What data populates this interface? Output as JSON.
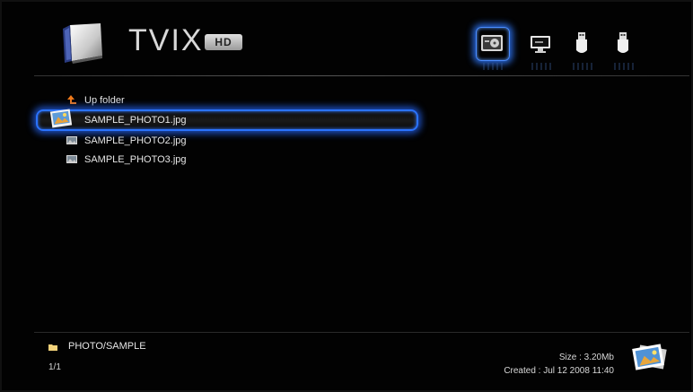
{
  "app": {
    "brand": "TVIX",
    "brand_badge": "HD"
  },
  "sources": [
    {
      "name": "hdd-source",
      "active": true
    },
    {
      "name": "network-source",
      "active": false
    },
    {
      "name": "usb-source-1",
      "active": false
    },
    {
      "name": "usb-source-2",
      "active": false
    }
  ],
  "list": {
    "up_label": "Up folder",
    "items": [
      {
        "label": "SAMPLE_PHOTO1.jpg",
        "selected": true
      },
      {
        "label": "SAMPLE_PHOTO2.jpg",
        "selected": false
      },
      {
        "label": "SAMPLE_PHOTO3.jpg",
        "selected": false
      }
    ]
  },
  "footer": {
    "path": "PHOTO/SAMPLE",
    "pager": "1/1",
    "size": "Size : 3.20Mb",
    "created": "Created : Jul 12 2008  11:40"
  },
  "colors": {
    "accent": "#2a73ff",
    "background": "#020202",
    "text": "#e6e6e6"
  }
}
